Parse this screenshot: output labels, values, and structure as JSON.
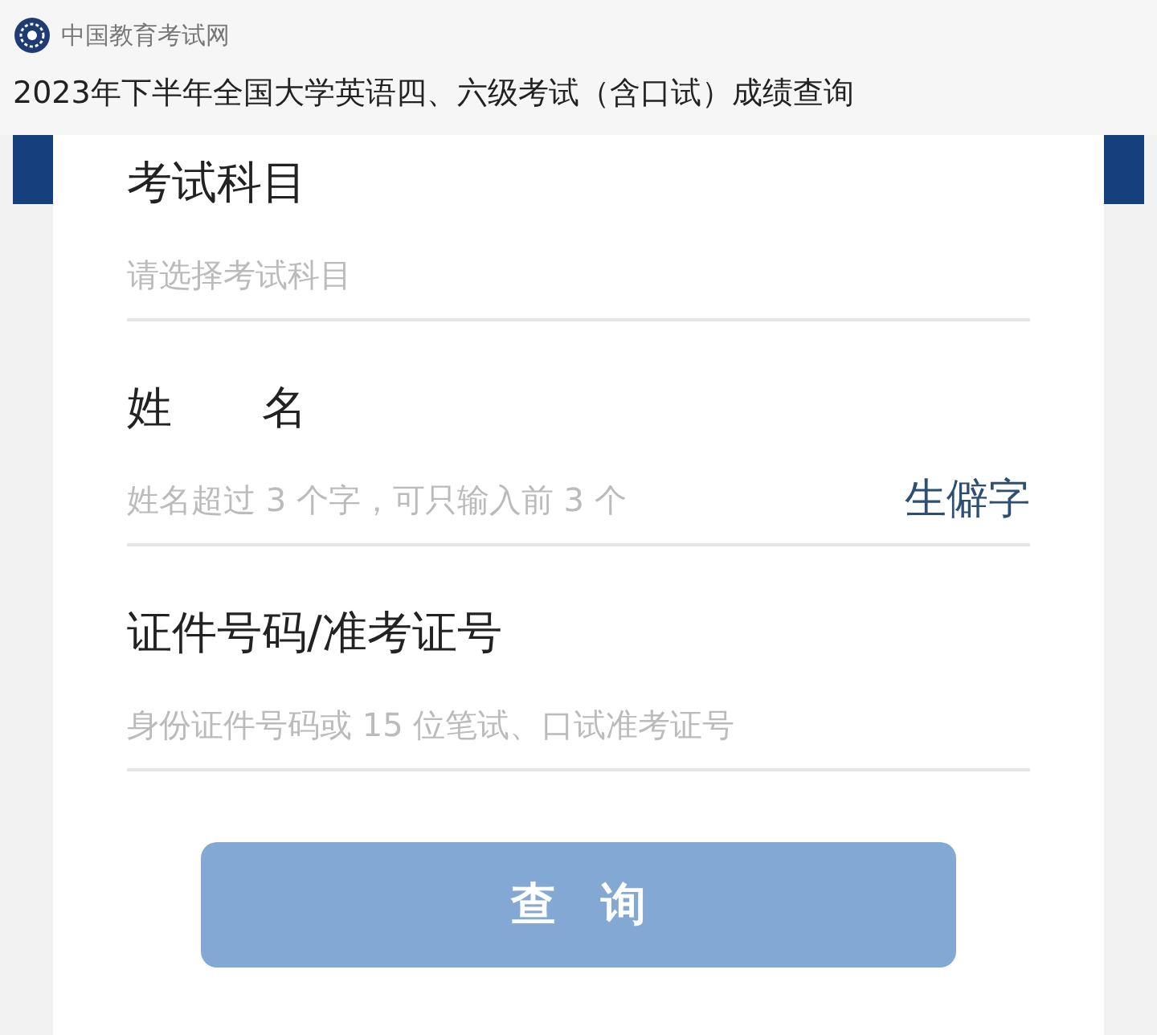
{
  "site": {
    "name": "中国教育考试网"
  },
  "page_title": "2023年下半年全国大学英语四、六级考试（含口试）成绩查询",
  "fields": [
    {
      "label": "考试科目",
      "placeholder": "请选择考试科目"
    },
    {
      "label": "姓　　名",
      "placeholder": "姓名超过 3 个字，可只输入前 3 个",
      "link": "生僻字"
    },
    {
      "label": "证件号码/准考证号",
      "placeholder": "身份证件号码或 15 位笔试、口试准考证号"
    }
  ],
  "submit": {
    "label": "查　询",
    "disabled": true
  }
}
